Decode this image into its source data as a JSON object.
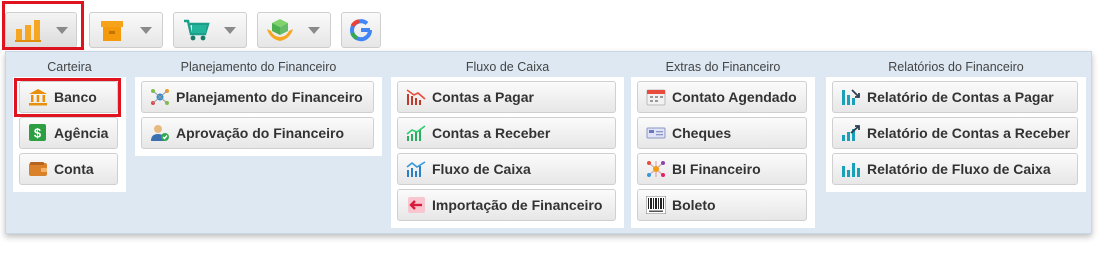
{
  "toolbar": {
    "buttons": [
      {
        "icon": "bar-chart-icon"
      },
      {
        "icon": "box-icon"
      },
      {
        "icon": "shopping-cart-icon"
      },
      {
        "icon": "hands-box-icon"
      },
      {
        "icon": "google-icon"
      }
    ]
  },
  "panel": {
    "columns": [
      {
        "title": "Carteira",
        "items": [
          {
            "label": "Banco",
            "icon": "bank-icon"
          },
          {
            "label": "Agência",
            "icon": "dollar-icon"
          },
          {
            "label": "Conta",
            "icon": "wallet-icon"
          }
        ]
      },
      {
        "title": "Planejamento do Financeiro",
        "items": [
          {
            "label": "Planejamento do Financeiro",
            "icon": "network-icon"
          },
          {
            "label": "Aprovação do Financeiro",
            "icon": "user-approval-icon"
          }
        ]
      },
      {
        "title": "Fluxo de Caixa",
        "items": [
          {
            "label": "Contas a Pagar",
            "icon": "chart-down-icon"
          },
          {
            "label": "Contas a Receber",
            "icon": "chart-up-icon"
          },
          {
            "label": "Fluxo de Caixa",
            "icon": "chart-flow-icon"
          },
          {
            "label": "Importação de Financeiro",
            "icon": "import-arrow-icon"
          }
        ]
      },
      {
        "title": "Extras do Financeiro",
        "items": [
          {
            "label": "Contato Agendado",
            "icon": "calendar-icon"
          },
          {
            "label": "Cheques",
            "icon": "cheque-icon"
          },
          {
            "label": "BI Financeiro",
            "icon": "bi-network-icon"
          },
          {
            "label": "Boleto",
            "icon": "barcode-icon"
          }
        ]
      },
      {
        "title": "Relatórios do Financeiro",
        "items": [
          {
            "label": "Relatório de Contas a Pagar",
            "icon": "report-down-icon"
          },
          {
            "label": "Relatório de Contas a Receber",
            "icon": "report-up-icon"
          },
          {
            "label": "Relatório de Fluxo de Caixa",
            "icon": "report-flow-icon"
          }
        ]
      }
    ]
  },
  "colors": {
    "highlight_frame": "#e0141e",
    "panel_bg": "#dde8f3"
  }
}
